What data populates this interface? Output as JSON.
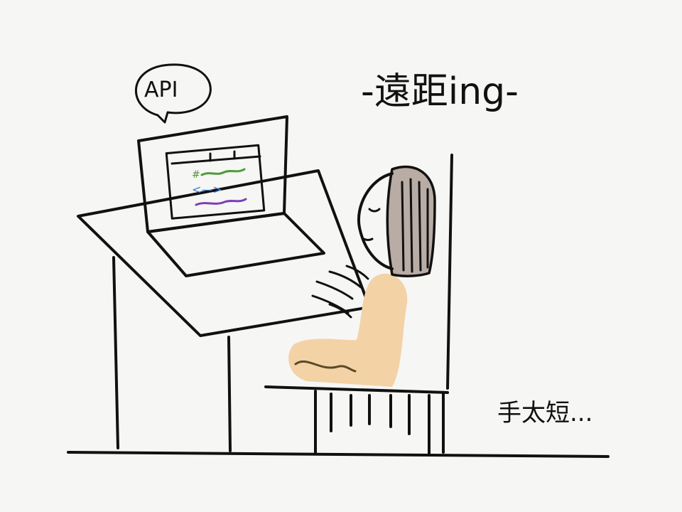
{
  "bubble_text": "API",
  "title_text": "-遠距ing-",
  "caption_text": "手太短...",
  "code_symbol": "#",
  "code_arrows": "<—>",
  "colors": {
    "background": "#f6f6f4",
    "ink": "#111111",
    "skin_body": "#f3d2a6",
    "hair": "#b9aca5",
    "code_green": "#4f9a3a",
    "code_blue": "#3a7fd6",
    "code_purple": "#7b3fb5",
    "sleeve_line": "#5a4a2a"
  }
}
